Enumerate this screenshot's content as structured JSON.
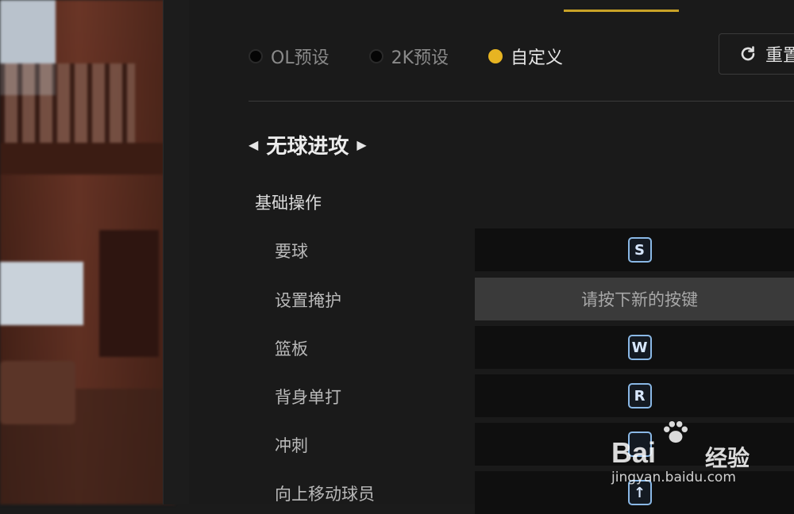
{
  "presets": [
    {
      "label": "OL预设",
      "active": false
    },
    {
      "label": "2K预设",
      "active": false
    },
    {
      "label": "自定义",
      "active": true
    }
  ],
  "reset_label": "重置",
  "section_title": "无球进攻",
  "subsection_title": "基础操作",
  "bindings": [
    {
      "label": "要球",
      "key": "S",
      "listening": false
    },
    {
      "label": "设置掩护",
      "key": "请按下新的按键",
      "listening": true
    },
    {
      "label": "篮板",
      "key": "W",
      "listening": false
    },
    {
      "label": "背身单打",
      "key": "R",
      "listening": false
    },
    {
      "label": "冲刺",
      "key": "",
      "listening": false
    },
    {
      "label": "向上移动球员",
      "key": "↑",
      "listening": false
    }
  ],
  "watermark": {
    "brand": "Bai",
    "brand_cn": "经验",
    "url": "jingyan.baidu.com"
  },
  "colors": {
    "accent": "#e7b422",
    "key_border": "#8ab8e6",
    "panel": "#1a1a1a"
  }
}
